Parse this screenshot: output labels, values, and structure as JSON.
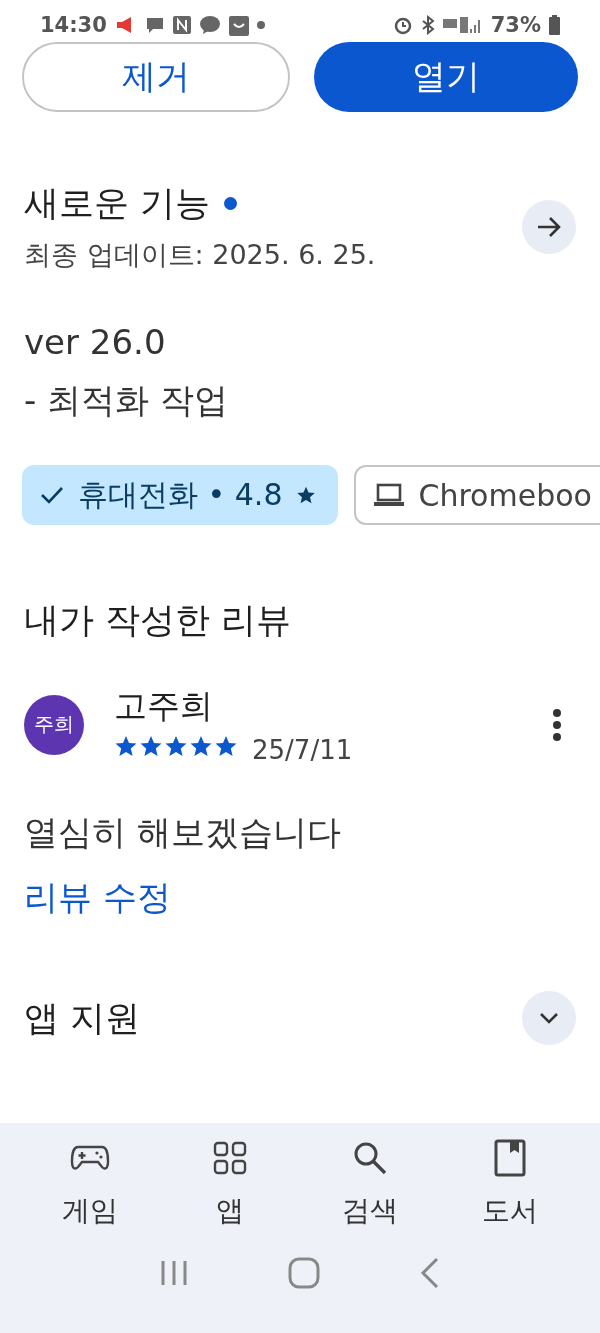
{
  "status_bar": {
    "time": "14:30",
    "battery": "73%"
  },
  "actions": [
    {
      "label": "제거",
      "kind": "outline"
    },
    {
      "label": "열기",
      "kind": "filled"
    }
  ],
  "whats_new": {
    "title": "새로운 기능",
    "new_dot": true,
    "updated": "최종 업데이트: 2025. 6. 25.",
    "notes": [
      "ver 26.0",
      "- 최적화 작업"
    ]
  },
  "devices": [
    {
      "label": "휴대전화 • 4.8",
      "rated": true,
      "selected": true
    },
    {
      "label": "Chromeboo",
      "rated": false,
      "selected": false
    }
  ],
  "my_review": {
    "title": "내가 작성한 리뷰",
    "avatar": "주희",
    "author": "고주희",
    "stars": 5,
    "date": "25/7/11",
    "text": "열심히 해보겠습니다",
    "edit_link": "리뷰 수정"
  },
  "app_support": {
    "title": "앱 지원",
    "expanded": false
  },
  "bottom_nav": [
    {
      "label": "게임",
      "kind": "games"
    },
    {
      "label": "앱",
      "kind": "apps"
    },
    {
      "label": "검색",
      "kind": "search"
    },
    {
      "label": "도서",
      "kind": "books"
    }
  ]
}
